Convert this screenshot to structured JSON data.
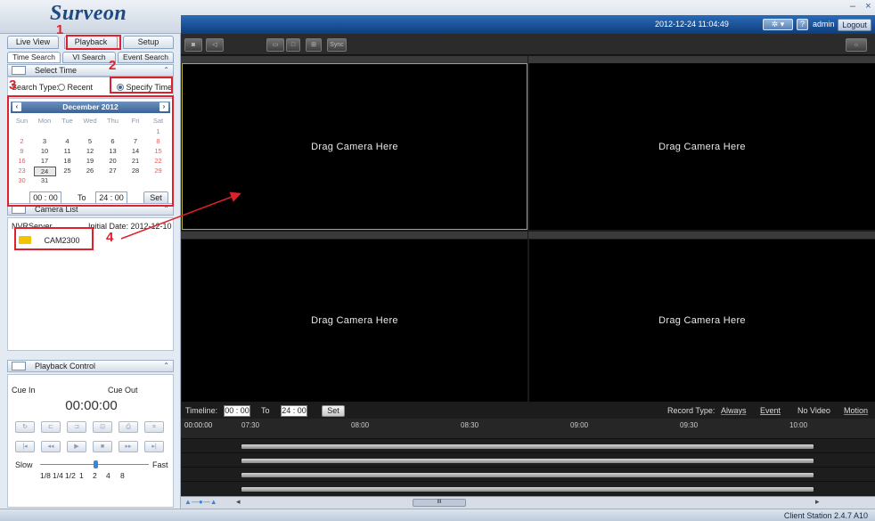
{
  "app": {
    "logo": "Surveon",
    "datetime": "2012-12-24 11:04:49",
    "settings_label": "✲ ▾",
    "help_label": "?",
    "user": "admin",
    "logout_label": "Logout",
    "window_controls": "– ×",
    "status": "Client Station 2.4.7 A10"
  },
  "main_tabs": [
    "Live View",
    "Playback",
    "Setup"
  ],
  "sub_tabs": [
    "Time Search",
    "VI Search",
    "Event Search"
  ],
  "select_time": {
    "title": "Select Time",
    "search_type_label": "Search Type:",
    "recent_label": "Recent",
    "specify_label": "Specify Time"
  },
  "calendar": {
    "month": "December 2012",
    "prev": "‹",
    "next": "›",
    "dow": [
      "Sun",
      "Mon",
      "Tue",
      "Wed",
      "Thu",
      "Fri",
      "Sat"
    ],
    "weeks": [
      [
        "",
        "",
        "",
        "",
        "",
        "",
        "1"
      ],
      [
        "2",
        "3",
        "4",
        "5",
        "6",
        "7",
        "8"
      ],
      [
        "9",
        "10",
        "11",
        "12",
        "13",
        "14",
        "15"
      ],
      [
        "16",
        "17",
        "18",
        "19",
        "20",
        "21",
        "22"
      ],
      [
        "23",
        "24",
        "25",
        "26",
        "27",
        "28",
        "29"
      ],
      [
        "30",
        "31",
        "",
        "",
        "",
        "",
        ""
      ]
    ],
    "selected_day": "24",
    "from_time": "00 : 00",
    "to_label": "To",
    "to_time": "24 : 00",
    "set_label": "Set"
  },
  "camera_list": {
    "title": "Camera List",
    "server": "NVRServer",
    "initial_date": "Initial Date: 2012-12-10",
    "camera": "CAM2300"
  },
  "playback_control": {
    "title": "Playback Control",
    "cue_in": "Cue In",
    "cue_out": "Cue Out",
    "time": "00:00:00",
    "row1": [
      "↻",
      "⊏",
      "⊐",
      "⊡",
      "⎙",
      "⌗"
    ],
    "row2": [
      "|◂",
      "◂◂",
      "▶",
      "■",
      "▸▸",
      "▸|"
    ],
    "slow": "Slow",
    "fast": "Fast",
    "speeds": [
      "1/8",
      "1/4",
      "1/2",
      "1",
      "2",
      "4",
      "8"
    ]
  },
  "annotations": [
    "1",
    "2",
    "3",
    "4"
  ],
  "toolbar": {
    "sync_label": "Sync"
  },
  "panes": [
    "Drag Camera Here",
    "Drag Camera Here",
    "Drag Camera Here",
    "Drag Camera Here"
  ],
  "timeline": {
    "label": "Timeline:",
    "from": "00 : 00",
    "to_label": "To",
    "to": "24 : 00",
    "set_label": "Set",
    "record_type_label": "Record Type:",
    "types": [
      "Always",
      "Event",
      "No Video",
      "Motion"
    ],
    "type_colors": [
      "#4a86d8",
      "#e8a020",
      "#888888",
      "#4cae4c"
    ],
    "current": "00:00:00",
    "ticks": [
      "07:30",
      "08:00",
      "08:30",
      "09:00",
      "09:30",
      "10:00"
    ],
    "scroll_label": "III"
  }
}
